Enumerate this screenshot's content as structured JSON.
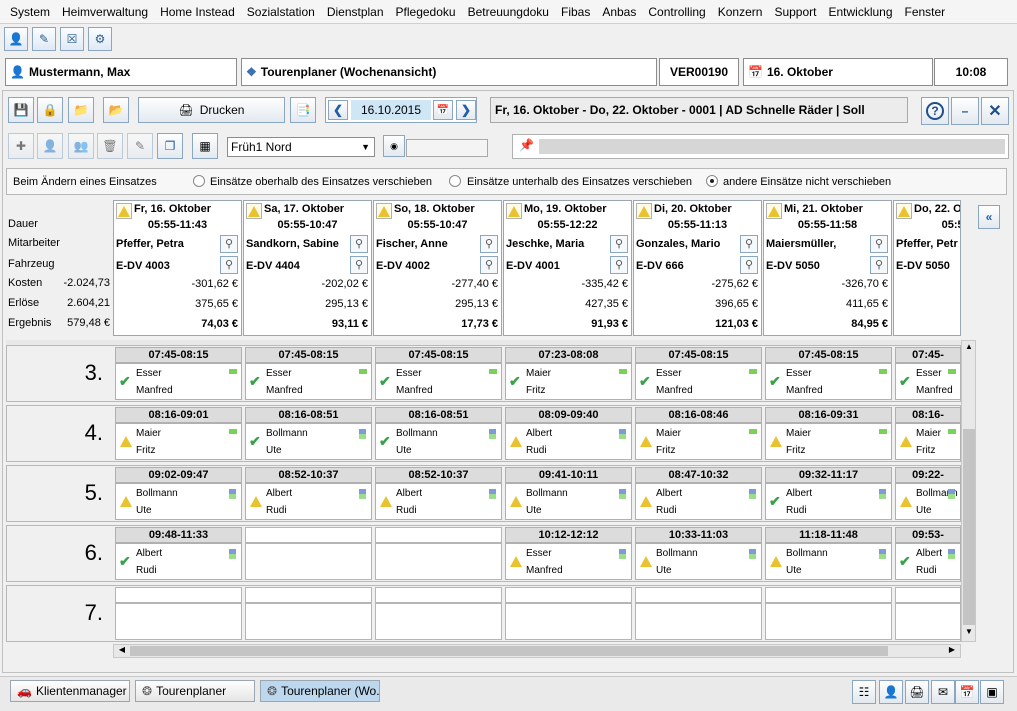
{
  "menu": [
    "System",
    "Heimverwaltung",
    "Home Instead",
    "Sozialstation",
    "Dienstplan",
    "Pflegedoku",
    "Betreuungdoku",
    "Fibas",
    "Anbas",
    "Controlling",
    "Konzern",
    "Support",
    "Entwicklung",
    "Fenster"
  ],
  "info": {
    "user": "Mustermann, Max",
    "module": "Tourenplaner (Wochenansicht)",
    "code": "VER00190",
    "date": "16. Oktober",
    "time": "10:08"
  },
  "toolbar": {
    "print_label": "Drucken",
    "date_value": "16.10.2015",
    "range_text": "Fr, 16. Oktober - Do, 22. Oktober  - 0001 | AD Schnelle Räder | Soll",
    "help": "?",
    "minimize": "–",
    "close": "✕",
    "tour_select": "Früh1 Nord"
  },
  "options": {
    "label": "Beim Ändern eines Einsatzes",
    "opt1": "Einsätze oberhalb des Einsatzes verschieben",
    "opt2": "Einsätze unterhalb des Einsatzes verschieben",
    "opt3": "andere Einsätze nicht verschieben"
  },
  "row_labels": {
    "dauer": "Dauer",
    "mitarbeiter": "Mitarbeiter",
    "fahrzeug": "Fahrzeug",
    "kosten": "Kosten",
    "erloese": "Erlöse",
    "ergebnis": "Ergebnis"
  },
  "totals": {
    "kosten": "-2.024,73",
    "erloese": "2.604,21",
    "ergebnis": "579,48 €"
  },
  "days": [
    {
      "title": "Fr, 16. Oktober",
      "time": "05:55-11:43",
      "emp": "Pfeffer, Petra",
      "veh": "E-DV 4003",
      "kosten": "-301,62 €",
      "erloese": "375,65 €",
      "ergebnis": "74,03 €"
    },
    {
      "title": "Sa, 17. Oktober",
      "time": "05:55-10:47",
      "emp": "Sandkorn, Sabine",
      "veh": "E-DV 4404",
      "kosten": "-202,02 €",
      "erloese": "295,13 €",
      "ergebnis": "93,11 €"
    },
    {
      "title": "So, 18. Oktober",
      "time": "05:55-10:47",
      "emp": "Fischer, Anne",
      "veh": "E-DV 4002",
      "kosten": "-277,40 €",
      "erloese": "295,13 €",
      "ergebnis": "17,73 €"
    },
    {
      "title": "Mo, 19. Oktober",
      "time": "05:55-12:22",
      "emp": "Jeschke, Maria",
      "veh": "E-DV 4001",
      "kosten": "-335,42 €",
      "erloese": "427,35 €",
      "ergebnis": "91,93 €"
    },
    {
      "title": "Di, 20. Oktober",
      "time": "05:55-11:13",
      "emp": "Gonzales, Mario",
      "veh": "E-DV  666",
      "kosten": "-275,62 €",
      "erloese": "396,65 €",
      "ergebnis": "121,03 €"
    },
    {
      "title": "Mi, 21. Oktober",
      "time": "05:55-11:58",
      "emp": "Maiersmüller,",
      "veh": "E-DV 5050",
      "kosten": "-326,70 €",
      "erloese": "411,65 €",
      "ergebnis": "84,95 €"
    },
    {
      "title": "Do, 22. O",
      "time": "05:55-",
      "emp": "Pfeffer, Petr",
      "veh": "E-DV 5050",
      "kosten": "",
      "erloese": "",
      "ergebnis": ""
    }
  ],
  "slots": [
    {
      "num": "3.",
      "cells": [
        {
          "time": "07:45-08:15",
          "s": "ok",
          "a": "Esser",
          "b": "Manfred",
          "f": "g"
        },
        {
          "time": "07:45-08:15",
          "s": "ok",
          "a": "Esser",
          "b": "Manfred",
          "f": "g"
        },
        {
          "time": "07:45-08:15",
          "s": "ok",
          "a": "Esser",
          "b": "Manfred",
          "f": "g"
        },
        {
          "time": "07:23-08:08",
          "s": "ok",
          "a": "Maier",
          "b": "Fritz",
          "f": "g"
        },
        {
          "time": "07:45-08:15",
          "s": "ok",
          "a": "Esser",
          "b": "Manfred",
          "f": "g"
        },
        {
          "time": "07:45-08:15",
          "s": "ok",
          "a": "Esser",
          "b": "Manfred",
          "f": "g"
        },
        {
          "time": "07:45-",
          "s": "ok",
          "a": "Esser",
          "b": "Manfred",
          "f": "g"
        }
      ]
    },
    {
      "num": "4.",
      "cells": [
        {
          "time": "08:16-09:01",
          "s": "warn",
          "a": "Maier",
          "b": "Fritz",
          "f": "g"
        },
        {
          "time": "08:16-08:51",
          "s": "ok",
          "a": "Bollmann",
          "b": "Ute",
          "f": "b"
        },
        {
          "time": "08:16-08:51",
          "s": "ok",
          "a": "Bollmann",
          "b": "Ute",
          "f": "b"
        },
        {
          "time": "08:09-09:40",
          "s": "warn",
          "a": "Albert",
          "b": "Rudi",
          "f": "b"
        },
        {
          "time": "08:16-08:46",
          "s": "warn",
          "a": "Maier",
          "b": "Fritz",
          "f": "g"
        },
        {
          "time": "08:16-09:31",
          "s": "warn",
          "a": "Maier",
          "b": "Fritz",
          "f": "g"
        },
        {
          "time": "08:16-",
          "s": "warn",
          "a": "Maier",
          "b": "Fritz",
          "f": "g"
        }
      ]
    },
    {
      "num": "5.",
      "cells": [
        {
          "time": "09:02-09:47",
          "s": "warn",
          "a": "Bollmann",
          "b": "Ute",
          "f": "b"
        },
        {
          "time": "08:52-10:37",
          "s": "warn",
          "a": "Albert",
          "b": "Rudi",
          "f": "b"
        },
        {
          "time": "08:52-10:37",
          "s": "warn",
          "a": "Albert",
          "b": "Rudi",
          "f": "b"
        },
        {
          "time": "09:41-10:11",
          "s": "warn",
          "a": "Bollmann",
          "b": "Ute",
          "f": "b"
        },
        {
          "time": "08:47-10:32",
          "s": "warn",
          "a": "Albert",
          "b": "Rudi",
          "f": "b"
        },
        {
          "time": "09:32-11:17",
          "s": "ok",
          "a": "Albert",
          "b": "Rudi",
          "f": "b"
        },
        {
          "time": "09:22-",
          "s": "warn",
          "a": "Bollmann",
          "b": "Ute",
          "f": "b"
        }
      ]
    },
    {
      "num": "6.",
      "cells": [
        {
          "time": "09:48-11:33",
          "s": "ok",
          "a": "Albert",
          "b": "Rudi",
          "f": "b"
        },
        null,
        null,
        {
          "time": "10:12-12:12",
          "s": "warn",
          "a": "Esser",
          "b": "Manfred",
          "f": "b"
        },
        {
          "time": "10:33-11:03",
          "s": "warn",
          "a": "Bollmann",
          "b": "Ute",
          "f": "b"
        },
        {
          "time": "11:18-11:48",
          "s": "warn",
          "a": "Bollmann",
          "b": "Ute",
          "f": "b"
        },
        {
          "time": "09:53-",
          "s": "ok",
          "a": "Albert",
          "b": "Rudi",
          "f": "b"
        }
      ]
    },
    {
      "num": "7.",
      "cells": [
        null,
        null,
        null,
        null,
        null,
        null,
        null
      ]
    }
  ],
  "taskbar": {
    "tab1": "Klientenmanager",
    "tab2": "Tourenplaner",
    "tab3": "Tourenplaner (Wo..."
  }
}
